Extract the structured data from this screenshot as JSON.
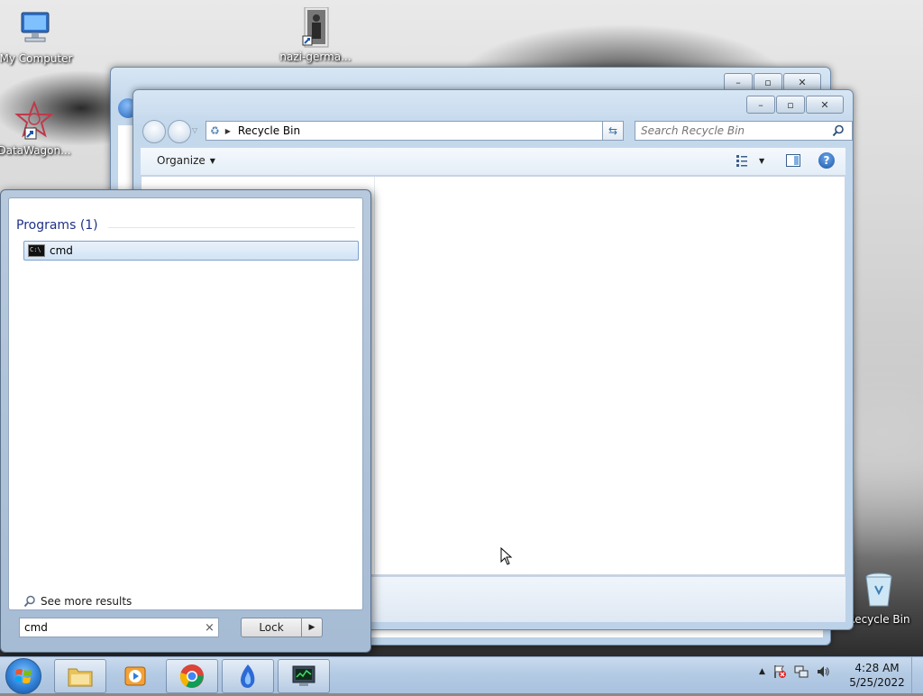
{
  "desktop": {
    "icons": [
      {
        "label": "My Computer",
        "icon": "computer-icon"
      },
      {
        "label": "nazi-germa...",
        "icon": "shortcut-photo-icon"
      },
      {
        "label": "DataWagon...",
        "icon": "datawagon-shortcut-icon"
      },
      {
        "label": "Recycle Bin",
        "icon": "recycle-bin-icon"
      }
    ]
  },
  "explorer": {
    "address": {
      "location": "Recycle Bin"
    },
    "search": {
      "placeholder": "Search Recycle Bin"
    },
    "toolbar": {
      "organize_label": "Organize"
    },
    "caption": {
      "minimize": "–",
      "maximize": "▫",
      "close": "✕"
    }
  },
  "start_menu": {
    "group_title": "Programs (1)",
    "results": [
      {
        "label": "cmd",
        "icon": "cmd-icon"
      }
    ],
    "see_more": "See more results",
    "search_value": "cmd",
    "clear_glyph": "×",
    "lock_label": "Lock",
    "lock_arrow": "▶"
  },
  "taskbar": {
    "pinned": [
      {
        "name": "explorer",
        "icon": "folder-icon"
      },
      {
        "name": "media-player",
        "icon": "media-player-icon"
      },
      {
        "name": "chrome",
        "icon": "chrome-icon"
      },
      {
        "name": "app",
        "icon": "blue-flame-icon"
      },
      {
        "name": "task-manager",
        "icon": "monitor-icon"
      }
    ],
    "tray_up_arrow": "▲",
    "clock": {
      "time": "4:28 AM",
      "date": "5/25/2022"
    }
  },
  "colors": {
    "accent": "#1e3287",
    "selection": "#d1e3f6"
  }
}
